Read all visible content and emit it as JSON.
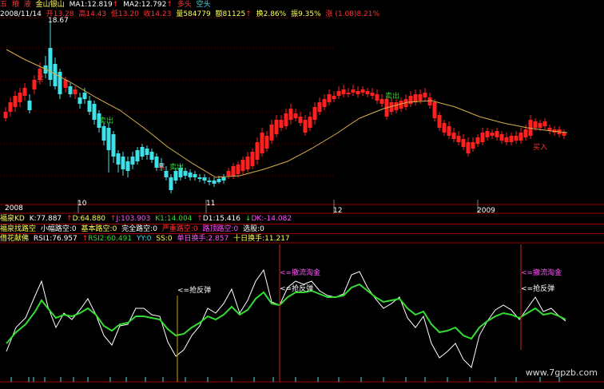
{
  "header": {
    "tabs": [
      {
        "label": "五",
        "color": "#ff3333"
      },
      {
        "label": "粮",
        "color": "#ff3333"
      },
      {
        "label": "液",
        "color": "#ff3333"
      }
    ],
    "stock_name": "金山银山",
    "ma1": "MA1:12.819",
    "ma2": "MA2:12.792",
    "arrow_ma1": "↑",
    "arrow_ma2": "↑",
    "signal_long": "多头",
    "signal_short": "空头"
  },
  "quote": {
    "date": "2008/11/14",
    "open": "开13.28",
    "high": "高14.43",
    "low": "低13.20",
    "close": "收14.23",
    "volume": "量584779",
    "amount": "额81125",
    "turnover": "换2.86%",
    "amplitude": "振9.35%",
    "change": "涨 (1.08)8.21%",
    "arrow": "↑"
  },
  "price_chart": {
    "high_label": "18.67",
    "annotations": [
      {
        "text": "买",
        "color": "#ff3333"
      },
      {
        "text": "卖出",
        "color": "#33cc33"
      },
      {
        "text": "买",
        "color": "#ff3333"
      },
      {
        "text": "卖出",
        "color": "#33cc33"
      },
      {
        "text": "卖出",
        "color": "#33cc33"
      },
      {
        "text": "买入",
        "color": "#ff3333"
      }
    ]
  },
  "time_axis": [
    "2008",
    "10",
    "11",
    "12",
    "2009"
  ],
  "indicator_kd": {
    "name": "福泉KD",
    "k": "K:77.887",
    "d": "D:64.880",
    "j": "J:103.903",
    "k1": "K1:14.004",
    "d1": "D1:15.416",
    "dk": "DK:-14.082",
    "arrow_up": "↑",
    "arrow_down": "↓"
  },
  "indicator_trend": {
    "name": "福泉找路空",
    "items": [
      {
        "text": "小幅路空:0",
        "color": "#ffffff"
      },
      {
        "text": "基本路空:0",
        "color": "#ffff55"
      },
      {
        "text": "完全路空:0",
        "color": "#ffffff"
      },
      {
        "text": "严重路空:0",
        "color": "#ff3333"
      },
      {
        "text": "路顶路空:0",
        "color": "#ff55ff"
      },
      {
        "text": "选股:0",
        "color": "#ffffff"
      }
    ]
  },
  "indicator_rsi": {
    "name": "借花献佛",
    "rsi1": "RSI1:76.957",
    "rsi2": "RSI2:60.491",
    "yy": "YY:0",
    "ss": "SS:0",
    "daily_turnover": "单日换手:2.857",
    "ten_day_turnover": "十日换手:11.217",
    "arrow": "↑",
    "annotations": [
      {
        "text": "<=抢反弹",
        "color": "#ffffff"
      },
      {
        "text": "<=撤流淘金",
        "color": "#ff55ff"
      },
      {
        "text": "<=抢反弹",
        "color": "#ffffff"
      },
      {
        "text": "<=撤流淘金",
        "color": "#ff55ff"
      },
      {
        "text": "<=抢反弹",
        "color": "#ffffff"
      }
    ]
  },
  "watermark": "www.7gpzb.com",
  "colors": {
    "up": "#ff2020",
    "down": "#40e0e8",
    "ma": "#d8b04a",
    "rsi1": "#ffffff",
    "rsi2": "#33dd33",
    "separator": "#a00000"
  }
}
